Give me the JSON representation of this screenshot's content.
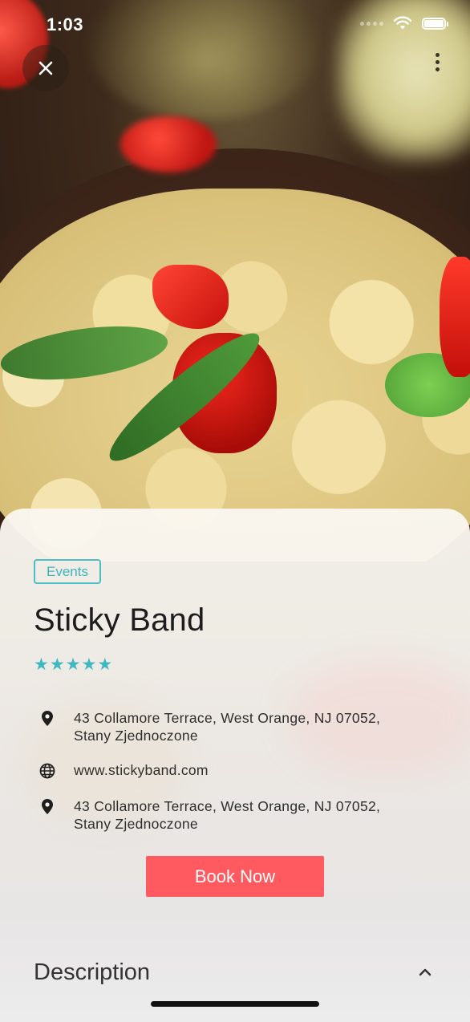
{
  "status_bar": {
    "time": "1:03"
  },
  "event": {
    "tag": "Events",
    "title": "Sticky Band",
    "rating": 5,
    "stars": [
      "★",
      "★",
      "★",
      "★",
      "★"
    ],
    "address_1": "43 Collamore Terrace, West Orange, NJ 07052, Stany Zjednoczone",
    "website": "www.stickyband.com",
    "address_2": "43 Collamore Terrace, West Orange, NJ 07052, Stany Zjednoczone"
  },
  "actions": {
    "book_label": "Book Now"
  },
  "description": {
    "title": "Description"
  },
  "colors": {
    "accent": "#3fb8c2",
    "button": "#ff5a5f"
  }
}
